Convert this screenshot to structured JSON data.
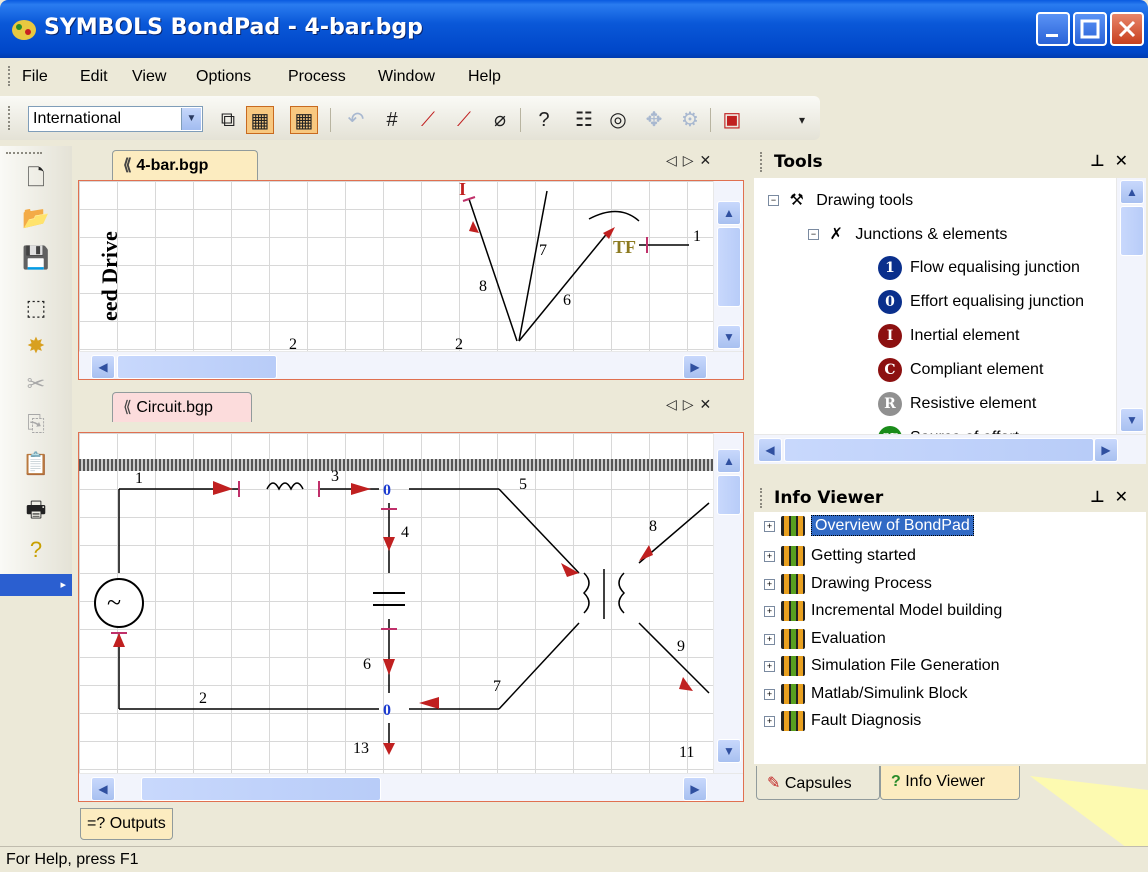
{
  "window": {
    "title": "SYMBOLS BondPad - 4-bar.bgp"
  },
  "menu": [
    "File",
    "Edit",
    "View",
    "Options",
    "Process",
    "Window",
    "Help"
  ],
  "toolbar": {
    "combo_value": "International"
  },
  "documents": [
    {
      "tab_label": "4-bar.bgp",
      "side_text": "eed Drive"
    },
    {
      "tab_label": "Circuit.bgp"
    }
  ],
  "diagram_4bar": {
    "labels": [
      "I",
      "7",
      "8",
      "6",
      "TF",
      "1",
      "2",
      "2"
    ]
  },
  "diagram_circuit": {
    "labels": [
      "1",
      "3",
      "0",
      "5",
      "4",
      "8",
      "6",
      "9",
      "2",
      "0",
      "7",
      "13",
      "11"
    ]
  },
  "tools_panel": {
    "title": "Tools",
    "items": [
      {
        "label": "Drawing tools",
        "level": 0
      },
      {
        "label": "Junctions & elements",
        "level": 1
      },
      {
        "label": "Flow equalising junction",
        "glyph": "1",
        "color": "#0a2f8c"
      },
      {
        "label": "Effort equalising junction",
        "glyph": "0",
        "color": "#0a2f8c"
      },
      {
        "label": "Inertial element",
        "glyph": "I",
        "color": "#8c1010"
      },
      {
        "label": "Compliant element",
        "glyph": "C",
        "color": "#8c1010"
      },
      {
        "label": "Resistive element",
        "glyph": "R",
        "color": "#909090"
      },
      {
        "label": "Source of effort",
        "glyph": "SE",
        "color": "#1a8c1a"
      }
    ]
  },
  "info_viewer": {
    "title": "Info Viewer",
    "items": [
      "Overview of BondPad",
      "Getting started",
      "Drawing Process",
      "Incremental Model building",
      "Evaluation",
      "Simulation File Generation",
      "Matlab/Simulink Block",
      "Fault Diagnosis"
    ],
    "selected": "Overview of BondPad"
  },
  "bottom_tabs": [
    "Capsules",
    "Info Viewer"
  ],
  "outputs_tab": "Outputs",
  "status": "For Help, press F1"
}
